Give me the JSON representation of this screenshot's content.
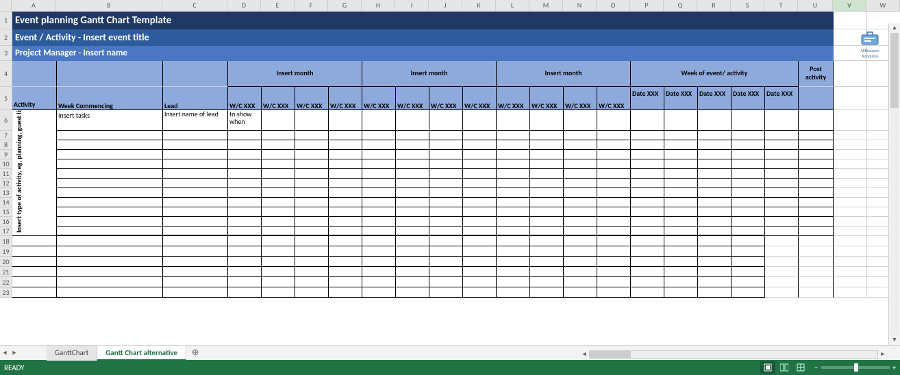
{
  "columns": [
    "A",
    "B",
    "C",
    "D",
    "E",
    "F",
    "G",
    "H",
    "I",
    "J",
    "K",
    "L",
    "M",
    "N",
    "O",
    "P",
    "Q",
    "R",
    "S",
    "T",
    "U",
    "V",
    "W"
  ],
  "selected_col": "V",
  "title1": "Event planning Gantt Chart Template",
  "title2": "Event / Activity - Insert event title",
  "title3": "Project Manager -  Insert name",
  "headers": {
    "activity": "Activity",
    "week_commencing": "Week Commencing",
    "lead": "Lead",
    "month_groups": [
      "Insert month",
      "Insert month",
      "Insert month",
      "Week of event/ activity"
    ],
    "post_activity": "Post activity",
    "wc_label": "W/C XXX",
    "date_label": "Date XXX"
  },
  "body": {
    "activity_rot": "Insert type of activity, eg, planning, guest list, programme, catering",
    "task_placeholder": "Insert tasks",
    "lead_placeholder": "Insert name of lead",
    "show_when": "to show when"
  },
  "row_count_template_body": 12,
  "row_count_plain": 6,
  "tabs": {
    "items": [
      "GanttChart",
      "Gantt Chart alternative"
    ],
    "active_index": 1
  },
  "status": {
    "ready": "READY",
    "zoom_minus": "−",
    "zoom_plus": "+"
  },
  "logo": {
    "line1": "AllBusiness",
    "line2": "Templates"
  }
}
